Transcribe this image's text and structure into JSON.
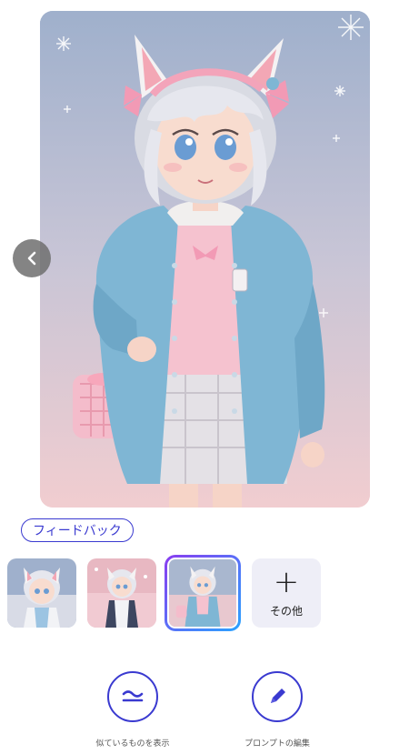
{
  "gallery": {
    "main_image": {
      "subject": "anime-girl-cat-ears-blue-cardigan"
    },
    "prev_icon": "chevron-left-icon"
  },
  "feedback": {
    "label": "フィードバック"
  },
  "thumbnails": [
    {
      "subject": "anime-girl-white-jacket",
      "selected": false
    },
    {
      "subject": "anime-girl-dark-vest",
      "selected": false
    },
    {
      "subject": "anime-girl-blue-cardigan",
      "selected": true
    }
  ],
  "more": {
    "icon": "plus-icon",
    "label": "その他"
  },
  "actions": [
    {
      "icon": "approx-equal-icon",
      "label": "似ているものを表示"
    },
    {
      "icon": "pen-icon",
      "label": "プロンプトの編集"
    }
  ],
  "colors": {
    "accent": "#3a3ad0",
    "selection_gradient_start": "#8a3cf0",
    "selection_gradient_end": "#2aa3ff",
    "more_tile_bg": "#eeeef7"
  }
}
